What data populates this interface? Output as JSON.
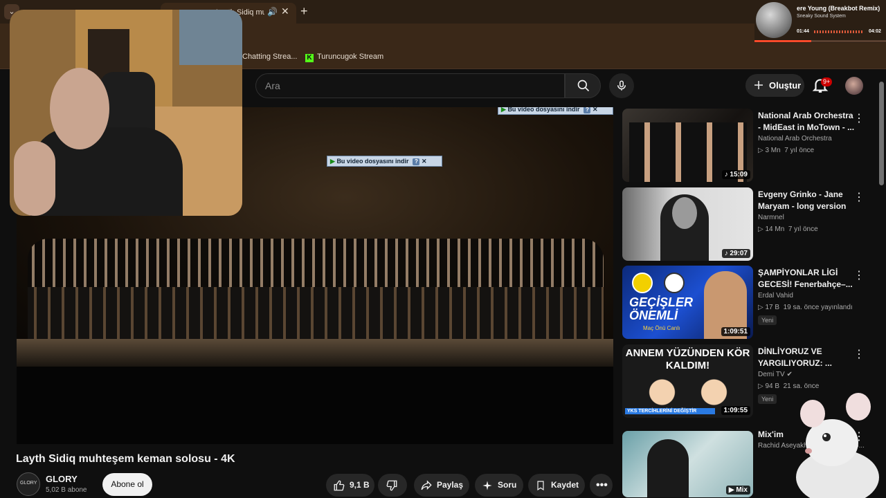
{
  "browser": {
    "tabs": [
      {
        "title": "Layth Sidiq muhteşem",
        "active": true
      }
    ],
    "bookmarks": [
      {
        "label": "Chatting Strea..."
      },
      {
        "label": "Turuncugok Stream"
      }
    ]
  },
  "media": {
    "title": "ere Young (Breakbot Remix)",
    "artist": "Sneaky Sound System",
    "current_time": "01:44",
    "total_time": "04:02",
    "progress": 0.43
  },
  "youtube": {
    "search_placeholder": "Ara",
    "create_label": "Oluştur",
    "notifications": "9+"
  },
  "player": {
    "download_banner": "Bu video dosyasını indir",
    "download_banner_help": "?"
  },
  "video": {
    "title": "Layth Sidiq muhteşem keman solosu - 4K",
    "channel": "GLORY",
    "avatar_text": "GLORY",
    "subscribers": "5,02 B abone",
    "subscribe_label": "Abone ol",
    "likes": "9,1 B",
    "share_label": "Paylaş",
    "ask_label": "Soru",
    "save_label": "Kaydet"
  },
  "recommendations": [
    {
      "title": "National Arab Orchestra - MidEast in MoTown - ...",
      "channel": "National Arab Orchestra",
      "views": "3 Mn",
      "age": "7 yıl önce",
      "duration": "15:09",
      "badge": ""
    },
    {
      "title": "Evgeny Grinko - Jane Maryam - long version",
      "channel": "Narmnel",
      "views": "14 Mn",
      "age": "7 yıl önce",
      "duration": "29:07",
      "badge": ""
    },
    {
      "title": "ŞAMPİYONLAR LİGİ GECESİ! Fenerbahçe–...",
      "channel": "Erdal Vahid",
      "views": "17 B",
      "age": "19 sa. önce yayınlandı",
      "duration": "1:09:51",
      "badge": "Yeni",
      "thumb_text": "GEÇİŞLER ÖNEMLİ",
      "thumb_sub": "Maç Önü Canlı"
    },
    {
      "title": "DİNLİYORUZ VE YARGILIYORUZ: ...",
      "channel": "Demi TV",
      "views": "94 B",
      "age": "21 sa. önce",
      "duration": "1:09:55",
      "badge": "Yeni",
      "thumb_text": "ANNEM YÜZÜNDEN KÖR KALDIM!",
      "thumb_sub": "YKS TERCİHLERİNİ DEĞİŞTİR"
    },
    {
      "title": "Mix'im",
      "channel": "Rachid Aseyakhe, Q-Tip, DIVA G...",
      "views": "",
      "age": "",
      "duration": "Mix",
      "badge": ""
    }
  ],
  "colors": {
    "tabbar": "#2b1f14",
    "toolbar": "#3a2818",
    "page_bg": "#0f0f0f",
    "accent_red": "#cc0000",
    "download_orange": "#f19a2c"
  }
}
